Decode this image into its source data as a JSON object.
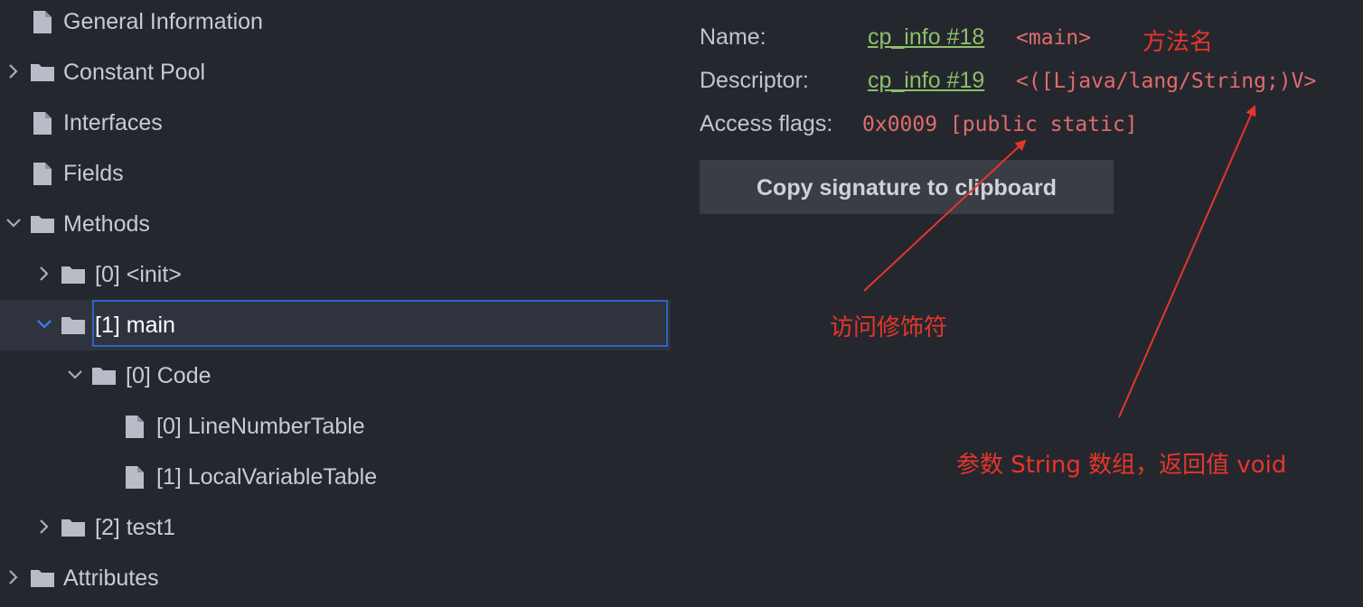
{
  "tree": {
    "items": [
      {
        "label": "General Information",
        "type": "file",
        "expanded": null
      },
      {
        "label": "Constant Pool",
        "type": "folder",
        "expanded": false
      },
      {
        "label": "Interfaces",
        "type": "file",
        "expanded": null
      },
      {
        "label": "Fields",
        "type": "file",
        "expanded": null
      },
      {
        "label": "Methods",
        "type": "folder",
        "expanded": true
      },
      {
        "label": "[0] <init>",
        "type": "folder",
        "expanded": false
      },
      {
        "label": "[1] main",
        "type": "folder",
        "expanded": true,
        "selected": true
      },
      {
        "label": "[0] Code",
        "type": "folder",
        "expanded": true
      },
      {
        "label": "[0] LineNumberTable",
        "type": "file",
        "expanded": null
      },
      {
        "label": "[1] LocalVariableTable",
        "type": "file",
        "expanded": null
      },
      {
        "label": "[2] test1",
        "type": "folder",
        "expanded": false
      },
      {
        "label": "Attributes",
        "type": "folder",
        "expanded": false
      }
    ]
  },
  "details": {
    "name_label": "Name:",
    "name_link": "cp_info #18",
    "name_value": "<main>",
    "descriptor_label": "Descriptor:",
    "descriptor_link": "cp_info #19",
    "descriptor_value": "<([Ljava/lang/String;)V>",
    "access_label": "Access flags:",
    "access_value": "0x0009 [public static]",
    "copy_button": "Copy signature to clipboard"
  },
  "annotations": {
    "method_name": "方法名",
    "access_modifier": "访问修饰符",
    "params_return": "参数 String 数组，返回值 void"
  },
  "colors": {
    "background": "#25272e",
    "selection_row": "#2f333d",
    "selection_border": "#2f63c8",
    "link": "#8dbf6a",
    "value": "#e06c6c",
    "annotation": "#e5362a"
  }
}
